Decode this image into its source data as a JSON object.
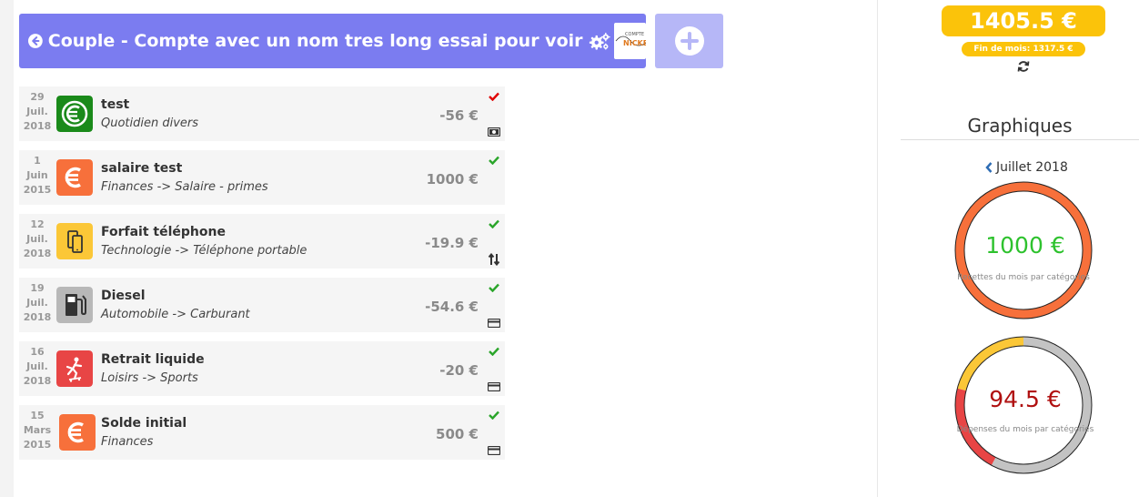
{
  "header": {
    "title": "Couple - Compte avec un nom tres long essai pour voir",
    "logo_text_top": "COMPTE",
    "logo_text_main": "NICKEL"
  },
  "transactions": [
    {
      "day": "29",
      "month": "Juil.",
      "year": "2018",
      "name": "test",
      "category": "Quotidien divers",
      "amount": "-56 €",
      "icon": "euro-icon",
      "icon_color": "#1a8a1a",
      "check_color": "#e00000",
      "payment": "cash-icon"
    },
    {
      "day": "1",
      "month": "Juin",
      "year": "2015",
      "name": "salaire test",
      "category": "Finances -> Salaire - primes",
      "amount": "1000 €",
      "icon": "euro-icon",
      "icon_color": "#f7703b",
      "check_color": "#2aa52a",
      "payment": ""
    },
    {
      "day": "12",
      "month": "Juil.",
      "year": "2018",
      "name": "Forfait téléphone",
      "category": "Technologie -> Téléphone portable",
      "amount": "-19.9 €",
      "icon": "phone-icon",
      "icon_color": "#fbc737",
      "check_color": "#2aa52a",
      "payment": "transfer-icon"
    },
    {
      "day": "19",
      "month": "Juil.",
      "year": "2018",
      "name": "Diesel",
      "category": "Automobile -> Carburant",
      "amount": "-54.6 €",
      "icon": "fuel-pump-icon",
      "icon_color": "#b8b8b8",
      "check_color": "#2aa52a",
      "payment": "card-icon"
    },
    {
      "day": "16",
      "month": "Juil.",
      "year": "2018",
      "name": "Retrait liquide",
      "category": "Loisirs -> Sports",
      "amount": "-20 €",
      "icon": "skater-icon",
      "icon_color": "#e84545",
      "check_color": "#2aa52a",
      "payment": "card-icon"
    },
    {
      "day": "15",
      "month": "Mars",
      "year": "2015",
      "name": "Solde initial",
      "category": "Finances",
      "amount": "500 €",
      "icon": "euro-icon",
      "icon_color": "#f7703b",
      "check_color": "#2aa52a",
      "payment": "card-icon"
    }
  ],
  "balance": {
    "amount": "1405.5 €",
    "end_of_month": "Fin de mois: 1317.5 €"
  },
  "charts": {
    "title": "Graphiques",
    "month": "Juillet 2018",
    "income": {
      "value": "1000 €",
      "label": "Recettes du mois par catégories",
      "value_color": "#2ec22e"
    },
    "expenses": {
      "value": "94.5 €",
      "label": "Dépenses du mois par catégories",
      "value_color": "#b01010"
    }
  },
  "chart_data": [
    {
      "type": "pie",
      "title": "",
      "categories": [
        "Finances"
      ],
      "values": [
        1000
      ],
      "colors": [
        "#f7703b"
      ]
    },
    {
      "type": "pie",
      "title": "",
      "categories": [
        "Automobile",
        "Loisirs",
        "Technologie"
      ],
      "values": [
        54.6,
        20,
        19.9
      ],
      "colors": [
        "#c3c3c3",
        "#e84545",
        "#fbc737"
      ]
    }
  ],
  "colors": {
    "header_bg": "#7b7cf0",
    "add_button_bg": "#b6b7f7",
    "balance_bg": "#fbc30a"
  }
}
